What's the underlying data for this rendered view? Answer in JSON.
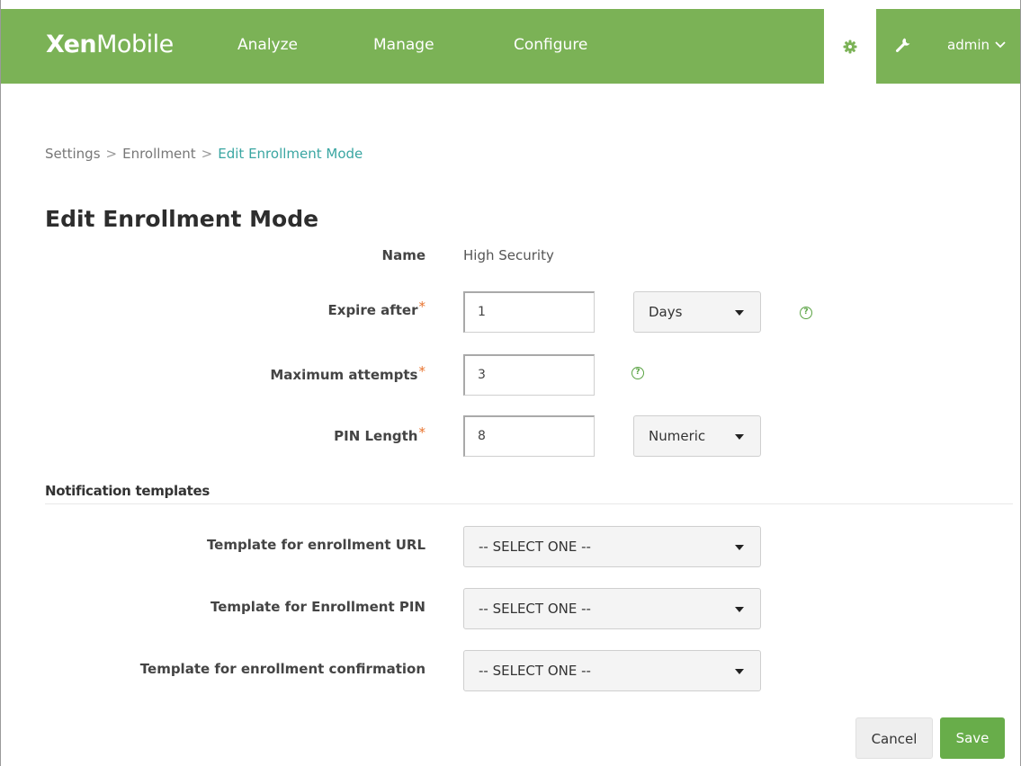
{
  "header": {
    "brand_bold": "Xen",
    "brand_light": "Mobile",
    "nav": [
      "Analyze",
      "Manage",
      "Configure"
    ],
    "user": "admin",
    "accent_color": "#7bb256"
  },
  "breadcrumb": {
    "items": [
      "Settings",
      "Enrollment"
    ],
    "separator": ">",
    "current": "Edit Enrollment Mode"
  },
  "page": {
    "title": "Edit Enrollment Mode"
  },
  "form": {
    "name_label": "Name",
    "name_value": "High Security",
    "expire_label": "Expire after",
    "expire_value": "1",
    "expire_unit": "Days",
    "attempts_label": "Maximum attempts",
    "attempts_value": "3",
    "pin_label": "PIN Length",
    "pin_value": "8",
    "pin_type": "Numeric",
    "required_mark": "*",
    "help_glyph": "?"
  },
  "notifications": {
    "section_title": "Notification templates",
    "url_label": "Template for enrollment URL",
    "url_value": "-- SELECT ONE --",
    "pin_label": "Template for Enrollment PIN",
    "pin_value": "-- SELECT ONE --",
    "confirm_label": "Template for enrollment confirmation",
    "confirm_value": "-- SELECT ONE --"
  },
  "actions": {
    "cancel": "Cancel",
    "save": "Save"
  }
}
